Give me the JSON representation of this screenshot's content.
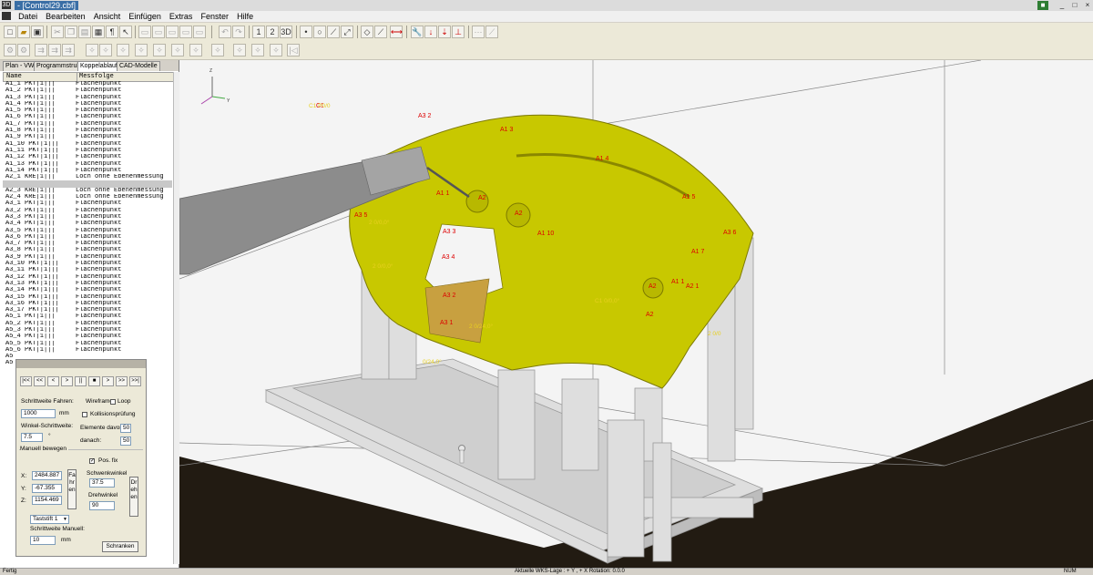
{
  "window": {
    "title": "- [Control29.cbf]",
    "minimize": "_",
    "maximize": "□",
    "close": "×"
  },
  "menu": [
    "Datei",
    "Bearbeiten",
    "Ansicht",
    "Einfügen",
    "Extras",
    "Fenster",
    "Hilfe"
  ],
  "tabs": [
    "Plan - VW",
    "Programmstruktur",
    "Koppelablauf",
    "CAD-Modelle"
  ],
  "list": {
    "header_name": "Name",
    "header_seq": "Messfolge",
    "rows": [
      {
        "name": "A1_1 PKT|1|||",
        "seq": "Flächenpunkt"
      },
      {
        "name": "A1_2 PKT|1|||",
        "seq": "Flächenpunkt"
      },
      {
        "name": "A1_3 PKT|1|||",
        "seq": "Flächenpunkt"
      },
      {
        "name": "A1_4 PKT|1|||",
        "seq": "Flächenpunkt"
      },
      {
        "name": "A1_5 PKT|1|||",
        "seq": "Flächenpunkt"
      },
      {
        "name": "A1_6 PKT|1|||",
        "seq": "Flächenpunkt"
      },
      {
        "name": "A1_7 PKT|1|||",
        "seq": "Flächenpunkt"
      },
      {
        "name": "A1_8 PKT|1|||",
        "seq": "Flächenpunkt"
      },
      {
        "name": "A1_9 PKT|1|||",
        "seq": "Flächenpunkt"
      },
      {
        "name": "A1_10 PKT|1|||",
        "seq": "Flächenpunkt"
      },
      {
        "name": "A1_11 PKT|1|||",
        "seq": "Flächenpunkt"
      },
      {
        "name": "A1_12 PKT|1|||",
        "seq": "Flächenpunkt"
      },
      {
        "name": "A1_13 PKT|1|||",
        "seq": "Flächenpunkt"
      },
      {
        "name": "A1_14 PKT|1|||",
        "seq": "Flächenpunkt"
      },
      {
        "name": "A2_1 KRE|1|||",
        "seq": "Loch ohne Ebenenmessung"
      },
      {
        "name": "",
        "seq": ""
      },
      {
        "name": "A2_3 KRE|1|||",
        "seq": "Loch ohne Ebenenmessung"
      },
      {
        "name": "A2_4 KRE|1|||",
        "seq": "Loch ohne Ebenenmessung"
      },
      {
        "name": "A3_1 PKT|1|||",
        "seq": "Flächenpunkt"
      },
      {
        "name": "A3_2 PKT|1|||",
        "seq": "Flächenpunkt"
      },
      {
        "name": "A3_3 PKT|1|||",
        "seq": "Flächenpunkt"
      },
      {
        "name": "A3_4 PKT|1|||",
        "seq": "Flächenpunkt"
      },
      {
        "name": "A3_5 PKT|1|||",
        "seq": "Flächenpunkt"
      },
      {
        "name": "A3_6 PKT|1|||",
        "seq": "Flächenpunkt"
      },
      {
        "name": "A3_7 PKT|1|||",
        "seq": "Flächenpunkt"
      },
      {
        "name": "A3_8 PKT|1|||",
        "seq": "Flächenpunkt"
      },
      {
        "name": "A3_9 PKT|1|||",
        "seq": "Flächenpunkt"
      },
      {
        "name": "A3_10 PKT|1|||",
        "seq": "Flächenpunkt"
      },
      {
        "name": "A3_11 PKT|1|||",
        "seq": "Flächenpunkt"
      },
      {
        "name": "A3_12 PKT|1|||",
        "seq": "Flächenpunkt"
      },
      {
        "name": "A3_13 PKT|1|||",
        "seq": "Flächenpunkt"
      },
      {
        "name": "A3_14 PKT|1|||",
        "seq": "Flächenpunkt"
      },
      {
        "name": "A3_15 PKT|1|||",
        "seq": "Flächenpunkt"
      },
      {
        "name": "A3_16 PKT|1|||",
        "seq": "Flächenpunkt"
      },
      {
        "name": "A3_17 PKT|1|||",
        "seq": "Flächenpunkt"
      },
      {
        "name": "A5_1 PKT|1|||",
        "seq": "Flächenpunkt"
      },
      {
        "name": "A5_2 PKT|1|||",
        "seq": "Flächenpunkt"
      },
      {
        "name": "A5_3 PKT|1|||",
        "seq": "Flächenpunkt"
      },
      {
        "name": "A5_4 PKT|1|||",
        "seq": "Flächenpunkt"
      },
      {
        "name": "A5_5 PKT|1|||",
        "seq": "Flächenpunkt"
      },
      {
        "name": "A5_6 PKT|1|||",
        "seq": "Flächenpunkt"
      },
      {
        "name": "A5",
        "seq": ""
      },
      {
        "name": "A5",
        "seq": ""
      }
    ]
  },
  "dialog": {
    "play_buttons": [
      "|<<",
      "<<",
      "<",
      ">",
      "||",
      "■",
      ">",
      ">>",
      ">>|"
    ],
    "step_label": "Schrittweite Fahren:",
    "wireframe": "Wireframe",
    "loop": "Loop",
    "step_value": "1000",
    "step_unit": "mm",
    "collision": "Kollisionsprüfung",
    "angle_label": "Winkel-Schrittweite:",
    "angle_value": "7.5",
    "angle_unit": "°",
    "elements_before": "Elemente davor:",
    "elements_before_value": "50",
    "after": "danach:",
    "after_value": "50",
    "manual_group": "Manuell bewegen",
    "pos_fix": "Pos. fix",
    "x_label": "X:",
    "x_value": "2484.887",
    "y_label": "Y:",
    "y_value": "-67.355",
    "z_label": "Z:",
    "z_value": "1154.469",
    "fahren": "Fahren",
    "schwenk_label": "Schwenkwinkel",
    "schwenk_value": "37.5",
    "dreh_label": "Drehwinkel",
    "dreh_value": "90",
    "drehen": "Drehen",
    "tool": "Taststift 1",
    "manual_step": "Schrittweite Manuell:",
    "manual_value": "10",
    "manual_unit": "mm",
    "schranken": "Schranken"
  },
  "scene": {
    "axis_z": "Z",
    "axis_y": "Y",
    "labels_red": [
      "A3 2",
      "A1 3",
      "A1 4",
      "A1 5",
      "A3 6",
      "A1 7",
      "A1 10",
      "A3 5",
      "A1 1",
      "A2",
      "A2",
      "A3 4",
      "A3 3",
      "A3 2",
      "A3 1",
      "A2",
      "A2",
      "A1 1",
      "A2 1",
      "C1"
    ],
    "labels_yellow": [
      "C1 P0/0",
      "2 0/0,0°",
      "2 0/0,0°",
      "C1 0/0,0°",
      "2 0/24,0°",
      "0/24,0°",
      "2 0/0"
    ]
  },
  "status": {
    "left": "Fertig",
    "center": "Aktuelle WKS-Lage : + Y , + X Rotation: 0.0.0",
    "right": "NUM"
  }
}
